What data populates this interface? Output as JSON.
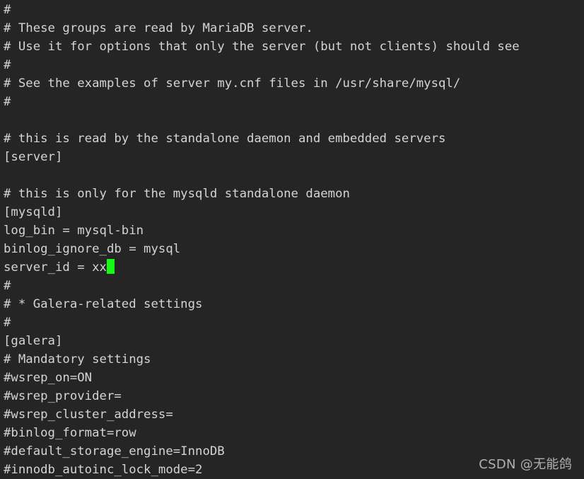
{
  "terminal": {
    "background_color": "#252526",
    "text_color": "#d4d4d4",
    "cursor_color": "#14fa14",
    "file_type": "mariadb-my-cnf",
    "lines": [
      "#",
      "# These groups are read by MariaDB server.",
      "# Use it for options that only the server (but not clients) should see",
      "#",
      "# See the examples of server my.cnf files in /usr/share/mysql/",
      "#",
      "",
      "# this is read by the standalone daemon and embedded servers",
      "[server]",
      "",
      "# this is only for the mysqld standalone daemon",
      "[mysqld]",
      "log_bin = mysql-bin",
      "binlog_ignore_db = mysql",
      "server_id = xx",
      "#",
      "# * Galera-related settings",
      "#",
      "[galera]",
      "# Mandatory settings",
      "#wsrep_on=ON",
      "#wsrep_provider=",
      "#wsrep_cluster_address=",
      "#binlog_format=row",
      "#default_storage_engine=InnoDB",
      "#innodb_autoinc_lock_mode=2"
    ],
    "cursor": {
      "line_index": 14,
      "after_text": "server_id = xx",
      "shape": "block"
    }
  },
  "watermark": {
    "text": "CSDN @无能鸽"
  }
}
